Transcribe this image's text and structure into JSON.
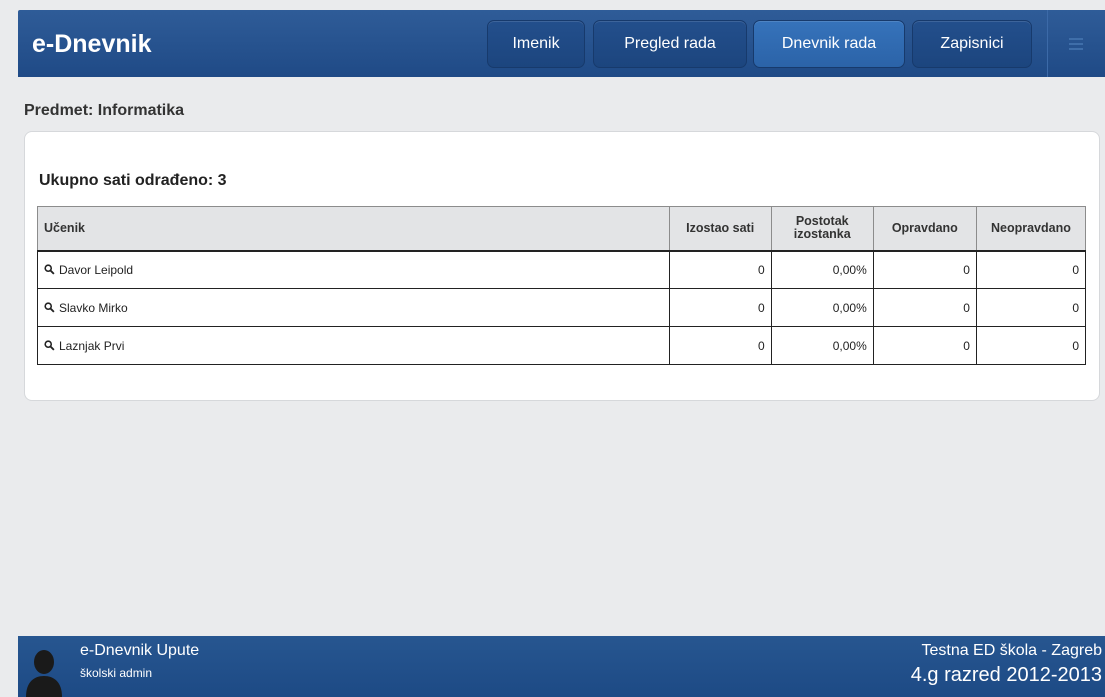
{
  "header": {
    "brand": "e-Dnevnik",
    "nav": [
      {
        "label": "Imenik"
      },
      {
        "label": "Pregled rada"
      },
      {
        "label": "Dnevnik rada"
      },
      {
        "label": "Zapisnici"
      }
    ],
    "active_tab": "Dnevnik rada"
  },
  "main": {
    "subject": "Predmet: Informatika",
    "total": "Ukupno sati odrađeno: 3",
    "table": {
      "columns": [
        "Učenik",
        "Izostao sati",
        "Postotak izostanka",
        "Opravdano",
        "Neopravdano"
      ],
      "column_lines": [
        [
          "Učenik"
        ],
        [
          "Izostao sati"
        ],
        [
          "Postotak",
          "izostanka"
        ],
        [
          "Opravdano"
        ],
        [
          "Neopravdano"
        ]
      ],
      "rows": [
        {
          "name": "Davor Leipold",
          "absent": "0",
          "percent": "0,00%",
          "justified": "0",
          "unjustified": "0"
        },
        {
          "name": "Slavko Mirko",
          "absent": "0",
          "percent": "0,00%",
          "justified": "0",
          "unjustified": "0"
        },
        {
          "name": "Laznjak Prvi",
          "absent": "0",
          "percent": "0,00%",
          "justified": "0",
          "unjustified": "0"
        }
      ]
    }
  },
  "footer": {
    "title": "e-Dnevnik Upute",
    "role": "školski admin",
    "school": "Testna ED škola - Zagreb",
    "class": "4.g razred 2012-2013"
  },
  "colors": {
    "header": "#2a5896",
    "active_tab": "#3270b8",
    "background": "#eaebed"
  },
  "icons": [
    "search-icon",
    "menu-icon",
    "user-avatar-icon"
  ]
}
